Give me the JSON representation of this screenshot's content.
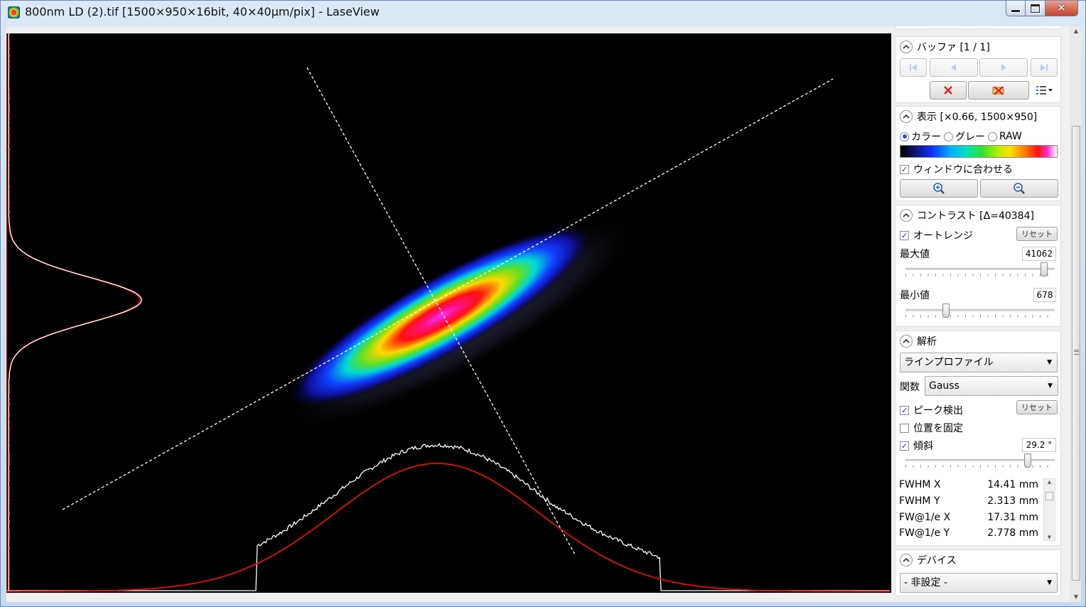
{
  "window": {
    "title": "800nm LD (2).tif [1500×950×16bit, 40×40µm/pix] - LaseView",
    "close_glyph": "✕"
  },
  "buffer": {
    "title": "バッファ [1 / 1]"
  },
  "display": {
    "title": "表示 [×0.66, 1500×950]",
    "radio_options": [
      "カラー",
      "グレー",
      "RAW"
    ],
    "selected": "カラー",
    "fit_window_label": "ウィンドウに合わせる",
    "fit_window_checked": true
  },
  "contrast": {
    "title": "コントラスト [Δ=40384]",
    "auto_range_label": "オートレンジ",
    "auto_range_checked": true,
    "reset_label": "リセット",
    "max_label": "最大値",
    "max_value": "41062",
    "max_slider_fraction": 0.93,
    "min_label": "最小値",
    "min_value": "678",
    "min_slider_fraction": 0.27
  },
  "analysis": {
    "title": "解析",
    "mode": "ラインプロファイル",
    "function_label": "関数",
    "function": "Gauss",
    "peak_detect_label": "ピーク検出",
    "peak_detect_checked": true,
    "reset_label": "リセット",
    "fix_position_label": "位置を固定",
    "fix_position_checked": false,
    "tilt_label": "傾斜",
    "tilt_checked": true,
    "tilt_value": "29.2 °",
    "tilt_slider_fraction": 0.82,
    "results": [
      {
        "key": "FWHM X",
        "value": "14.41 mm"
      },
      {
        "key": "FWHM Y",
        "value": "2.313 mm"
      },
      {
        "key": "FW@1/e X",
        "value": "17.31 mm"
      },
      {
        "key": "FW@1/e Y",
        "value": "2.778 mm"
      }
    ]
  },
  "device": {
    "title": "デバイス",
    "selected": "- 非設定 -"
  },
  "colors": {
    "fit_curve": "#e01010",
    "profile": "#ffffff",
    "accent": "#2a5fbd"
  }
}
